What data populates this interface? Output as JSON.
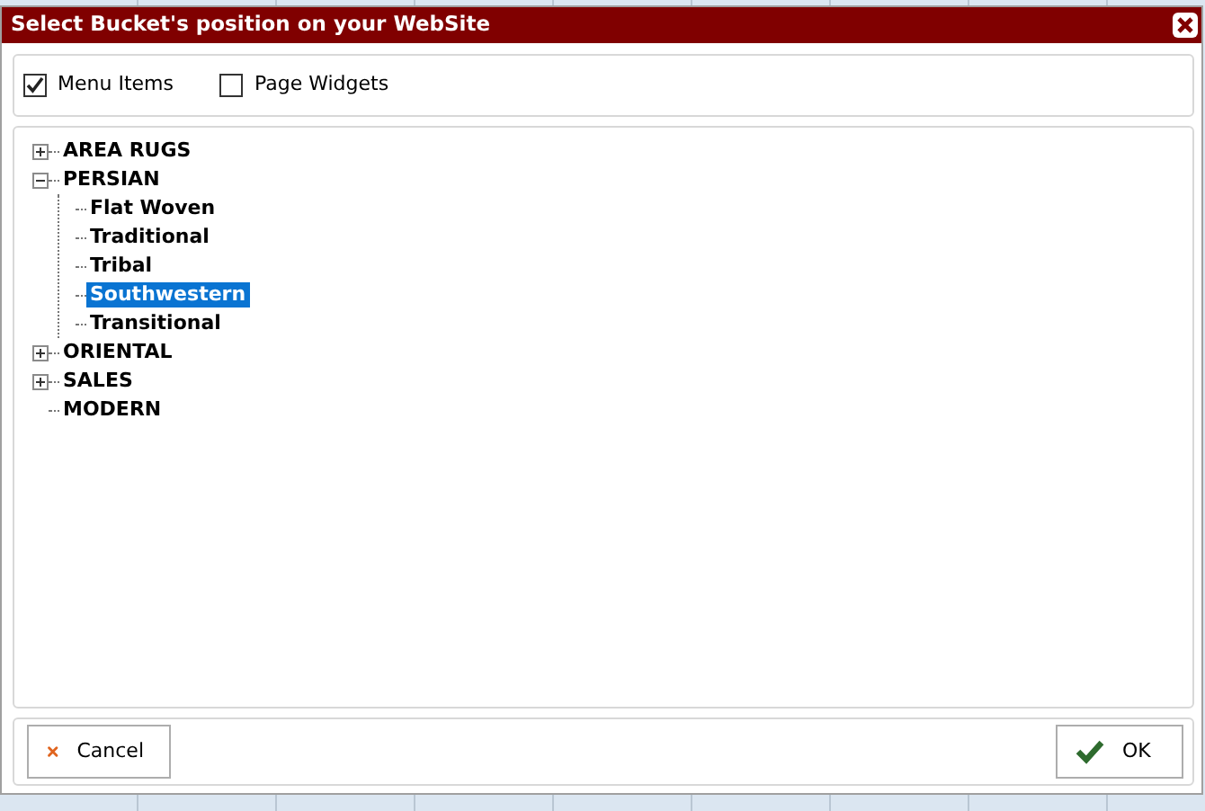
{
  "window": {
    "title": "Select Bucket's position on your WebSite"
  },
  "options": [
    {
      "label": "Menu Items",
      "checked": true
    },
    {
      "label": "Page Widgets",
      "checked": false
    }
  ],
  "tree": [
    {
      "label": "AREA RUGS",
      "kind": "folder",
      "expanded": false,
      "selected": false
    },
    {
      "label": "PERSIAN",
      "kind": "folder",
      "expanded": true,
      "selected": false,
      "children": [
        {
          "label": "Flat Woven",
          "kind": "leaf",
          "selected": false
        },
        {
          "label": "Traditional",
          "kind": "leaf",
          "selected": false
        },
        {
          "label": "Tribal",
          "kind": "leaf",
          "selected": false
        },
        {
          "label": "Southwestern",
          "kind": "leaf",
          "selected": true
        },
        {
          "label": "Transitional",
          "kind": "leaf",
          "selected": false
        }
      ]
    },
    {
      "label": "ORIENTAL",
      "kind": "folder",
      "expanded": false,
      "selected": false
    },
    {
      "label": "SALES",
      "kind": "folder",
      "expanded": false,
      "selected": false
    },
    {
      "label": "MODERN",
      "kind": "leaf",
      "selected": false
    }
  ],
  "buttons": [
    {
      "label": "Cancel",
      "kind": "cancel"
    },
    {
      "label": "OK",
      "kind": "ok"
    }
  ]
}
